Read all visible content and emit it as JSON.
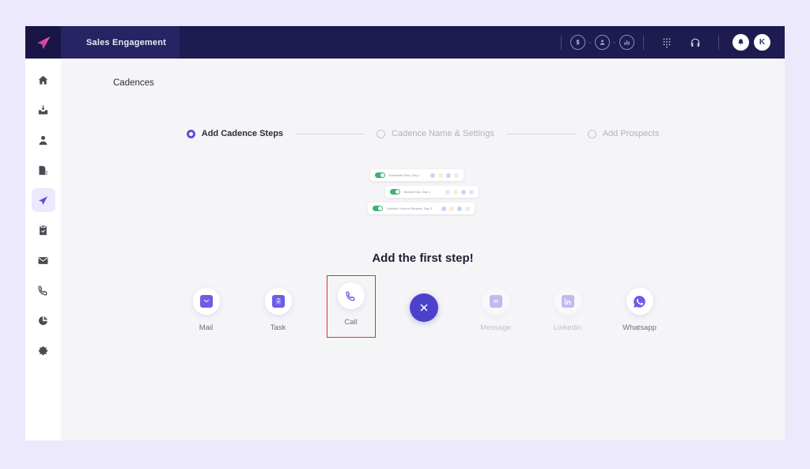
{
  "app": {
    "brand_title": "Sales Engagement",
    "logo_icon": "paper-plane-icon"
  },
  "topbar": {
    "icons": [
      {
        "name": "dollar-circle-icon",
        "glyph": "$"
      },
      {
        "name": "person-circle-icon",
        "glyph": "●"
      },
      {
        "name": "report-circle-icon",
        "glyph": "■"
      },
      {
        "name": "dialpad-icon",
        "glyph": "dialpad"
      },
      {
        "name": "headset-icon",
        "glyph": "headset"
      },
      {
        "name": "notification-bell-icon",
        "glyph": "bell"
      }
    ],
    "avatar_initial": "K"
  },
  "sidebar": {
    "items": [
      {
        "name": "sidebar-item-home",
        "icon": "home-icon",
        "active": false
      },
      {
        "name": "sidebar-item-inbox",
        "icon": "inbox-download-icon",
        "active": false
      },
      {
        "name": "sidebar-item-contacts",
        "icon": "person-icon",
        "active": false
      },
      {
        "name": "sidebar-item-documents",
        "icon": "document-list-icon",
        "active": false
      },
      {
        "name": "sidebar-item-cadences",
        "icon": "paper-plane-icon",
        "active": true
      },
      {
        "name": "sidebar-item-tasks",
        "icon": "clipboard-check-icon",
        "active": false
      },
      {
        "name": "sidebar-item-mail",
        "icon": "envelope-icon",
        "active": false
      },
      {
        "name": "sidebar-item-calls",
        "icon": "phone-icon",
        "active": false
      },
      {
        "name": "sidebar-item-reports",
        "icon": "pie-chart-icon",
        "active": false
      },
      {
        "name": "sidebar-item-settings",
        "icon": "gear-icon",
        "active": false
      }
    ]
  },
  "main": {
    "page_title": "Cadences",
    "stepper": [
      {
        "label": "Add Cadence Steps",
        "active": true
      },
      {
        "label": "Cadence Name & Settings",
        "active": false
      },
      {
        "label": "Add Prospects",
        "active": false
      }
    ],
    "illustration_rows": [
      {
        "label": "Automated Step, Day 1",
        "enabled": true
      },
      {
        "label": "Manual Step, Day 2",
        "enabled": true
      },
      {
        "label": "LinkedIn Connect Request, Day 3",
        "enabled": true
      }
    ],
    "headline": "Add the first step!",
    "options": [
      {
        "label": "Mail",
        "icon": "envelope-icon",
        "state": "normal"
      },
      {
        "label": "Task",
        "icon": "clipboard-check-icon",
        "state": "normal"
      },
      {
        "label": "Call",
        "icon": "phone-icon",
        "state": "highlighted"
      },
      {
        "label": "",
        "icon": "close-x-icon",
        "state": "close"
      },
      {
        "label": "Message",
        "icon": "chat-bubble-icon",
        "state": "disabled"
      },
      {
        "label": "Linkedin",
        "icon": "linkedin-icon",
        "state": "disabled"
      },
      {
        "label": "Whatsapp",
        "icon": "whatsapp-icon",
        "state": "normal"
      }
    ]
  },
  "colors": {
    "topbar_bg": "#1d1b4f",
    "accent_purple": "#5b4fd6",
    "close_button": "#4b42cb",
    "highlight_border": "#e0312a",
    "toggle_on": "#3cb371",
    "page_bg": "#ebe9fb",
    "content_bg": "#f5f5f7"
  }
}
